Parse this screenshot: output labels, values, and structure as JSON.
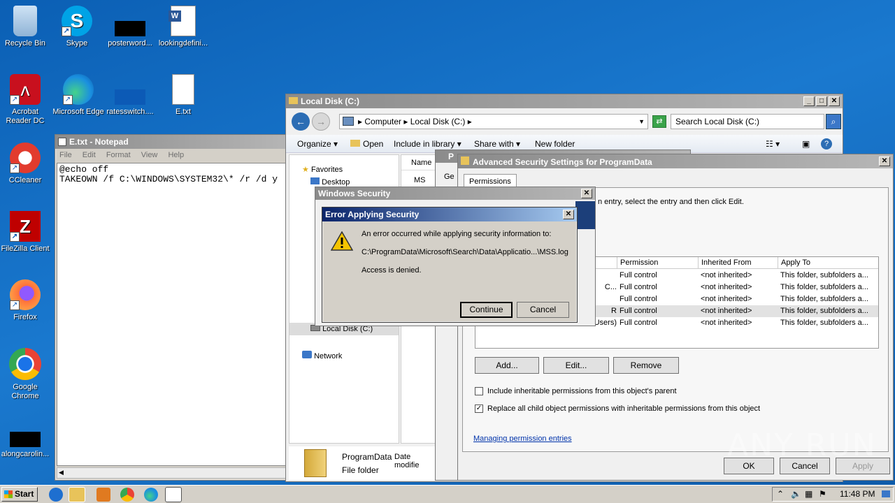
{
  "desktop": {
    "icons": [
      {
        "label": "Recycle Bin"
      },
      {
        "label": "Skype"
      },
      {
        "label": "posterword..."
      },
      {
        "label": "lookingdefini..."
      },
      {
        "label": "Acrobat Reader DC"
      },
      {
        "label": "Microsoft Edge"
      },
      {
        "label": "ratesswitch...."
      },
      {
        "label": "E.txt"
      },
      {
        "label": "CCleaner"
      },
      {
        "label": "FileZilla Client"
      },
      {
        "label": "Firefox"
      },
      {
        "label": "Google Chrome"
      },
      {
        "label": "alongcarolin..."
      }
    ]
  },
  "notepad": {
    "title": "E.txt - Notepad",
    "menu": [
      "File",
      "Edit",
      "Format",
      "View",
      "Help"
    ],
    "lines": [
      "@echo off",
      "TAKEOWN /f C:\\WINDOWS\\SYSTEM32\\* /r /d y"
    ]
  },
  "explorer": {
    "title": "Local Disk (C:)",
    "breadcrumb": [
      "Computer",
      "Local Disk (C:)"
    ],
    "search_placeholder": "Search Local Disk (C:)",
    "toolbar": [
      "Organize",
      "Open",
      "Include in library",
      "Share with",
      "New folder"
    ],
    "nav": {
      "favorites": "Favorites",
      "desktop": "Desktop",
      "local_disk": "Local Disk (C:)",
      "network": "Network"
    },
    "column_name": "Name",
    "list_first": "MS",
    "details": {
      "name": "ProgramData",
      "modified_label": "Date modifie",
      "type": "File folder"
    }
  },
  "adv_security": {
    "title": "Advanced Security Settings for ProgramData",
    "tab": "Permissions",
    "instruction": "n entry, select the entry and then click Edit.",
    "columns": [
      "Permission",
      "Inherited From",
      "Apply To"
    ],
    "rows": [
      {
        "name": "",
        "permission": "Full control",
        "inherited": "<not inherited>",
        "apply": "This folder, subfolders a..."
      },
      {
        "name": "C...",
        "permission": "Full control",
        "inherited": "<not inherited>",
        "apply": "This folder, subfolders a..."
      },
      {
        "name": "",
        "permission": "Full control",
        "inherited": "<not inherited>",
        "apply": "This folder, subfolders a..."
      },
      {
        "name": "R",
        "permission": "Full control",
        "inherited": "<not inherited>",
        "apply": "This folder, subfolders a..."
      },
      {
        "name": "Users)",
        "permission": "Full control",
        "inherited": "<not inherited>",
        "apply": "This folder, subfolders a..."
      }
    ],
    "buttons": {
      "add": "Add...",
      "edit": "Edit...",
      "remove": "Remove"
    },
    "include_inheritable": "Include inheritable permissions from this object's parent",
    "replace_child": "Replace all child object permissions with inheritable permissions from this object",
    "replace_checked": true,
    "manage_link": "Managing permission entries",
    "ok": "OK",
    "cancel": "Cancel",
    "apply": "Apply"
  },
  "props_partial": {
    "title": "P",
    "tab": "Ge"
  },
  "windows_security": {
    "title": "Windows Security"
  },
  "error_dialog": {
    "title": "Error Applying Security",
    "message": "An error occurred while applying security information to:",
    "path": "C:\\ProgramData\\Microsoft\\Search\\Data\\Applicatio...\\MSS.log",
    "detail": "Access is denied.",
    "continue": "Continue",
    "cancel": "Cancel"
  },
  "taskbar": {
    "start": "Start",
    "time": "11:48 PM"
  },
  "watermark": "ANY RUN"
}
